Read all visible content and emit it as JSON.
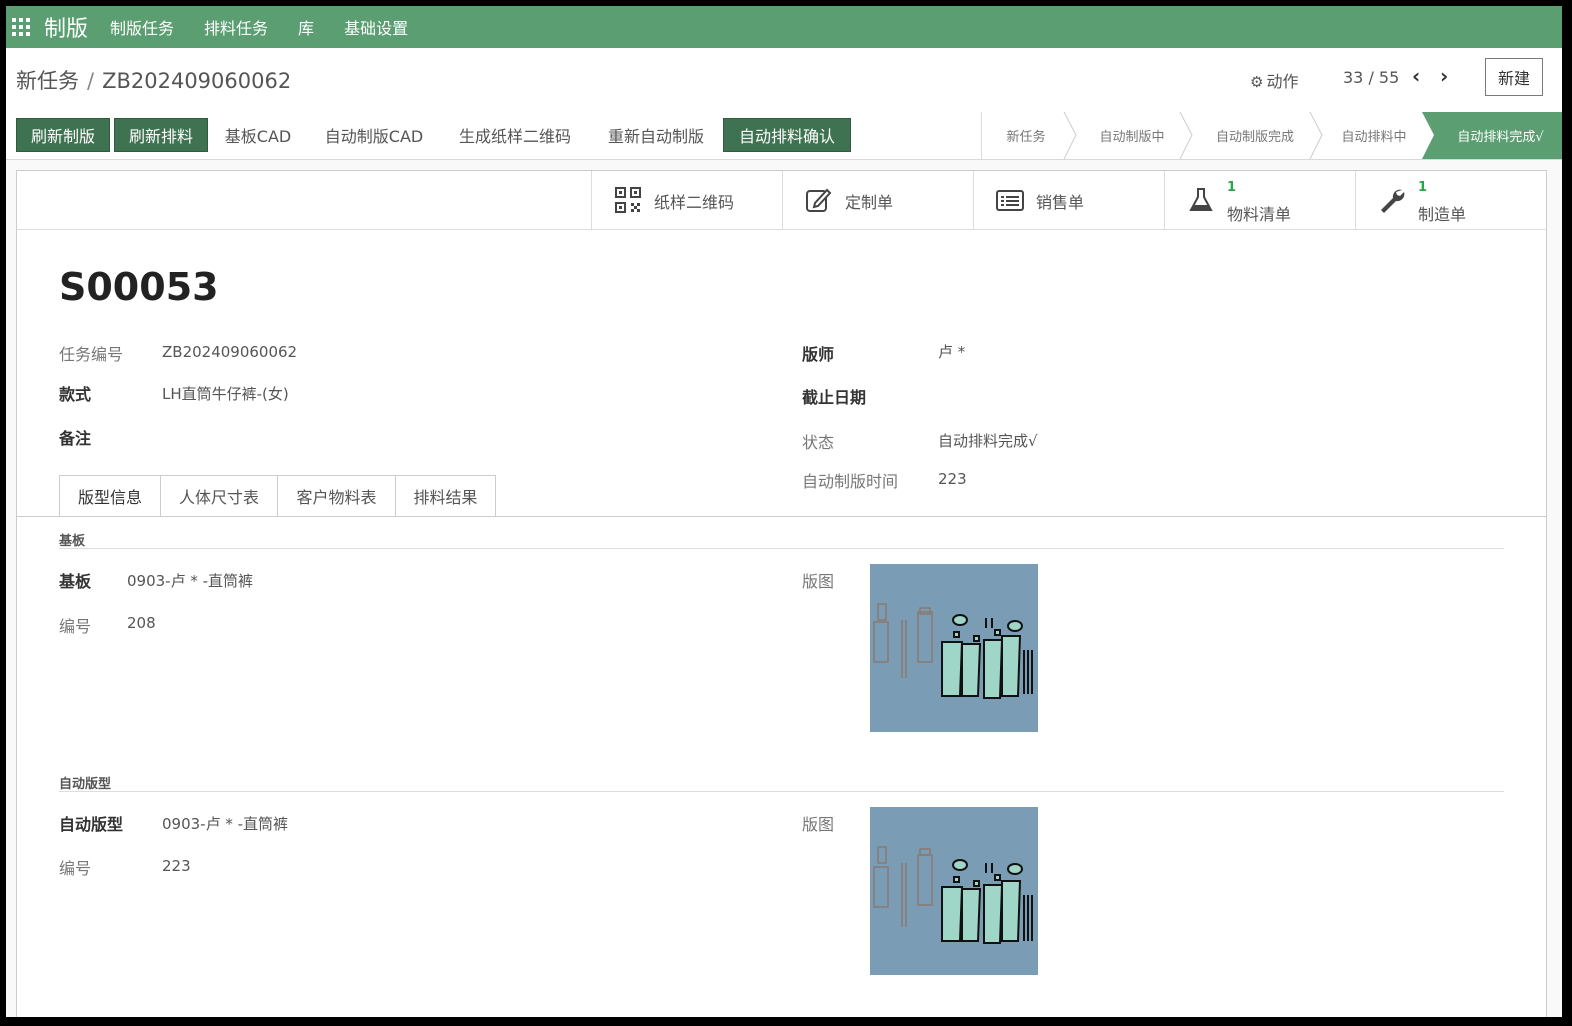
{
  "topnav": {
    "app_name": "制版",
    "items": [
      "制版任务",
      "排料任务",
      "库",
      "基础设置"
    ]
  },
  "header": {
    "breadcrumb_parent": "新任务",
    "breadcrumb_current": "ZB202409060062",
    "action_label": "动作",
    "pager": "33 / 55",
    "new_label": "新建"
  },
  "statusbar": {
    "buttons": [
      "刷新制版",
      "刷新排料",
      "基板CAD",
      "自动制版CAD",
      "生成纸样二维码",
      "重新自动制版",
      "自动排料确认"
    ],
    "steps": [
      "新任务",
      "自动制版中",
      "自动制版完成",
      "自动排料中",
      "自动排料完成√"
    ]
  },
  "smart_buttons": {
    "qr": "纸样二维码",
    "custom": "定制单",
    "sales": "销售单",
    "bom_count": "1",
    "bom": "物料清单",
    "mo_count": "1",
    "mo": "制造单"
  },
  "record": {
    "title": "S00053",
    "left": {
      "task_no_label": "任务编号",
      "task_no": "ZB202409060062",
      "style_label": "款式",
      "style": "LH直筒牛仔裤-(女)",
      "note_label": "备注"
    },
    "right": {
      "maker_label": "版师",
      "maker": "卢 *",
      "deadline_label": "截止日期",
      "state_label": "状态",
      "state": "自动排料完成√",
      "auto_time_label": "自动制版时间",
      "auto_time": "223"
    }
  },
  "tabs": [
    "版型信息",
    "人体尺寸表",
    "客户物料表",
    "排料结果"
  ],
  "base_section": {
    "title": "基板",
    "base_label": "基板",
    "base_value": "0903-卢 * -直筒裤",
    "no_label": "编号",
    "no_value": "208",
    "image_label": "版图"
  },
  "auto_section": {
    "title": "自动版型",
    "pattern_label": "自动版型",
    "pattern_value": "0903-卢 * -直筒裤",
    "no_label": "编号",
    "no_value": "223",
    "image_label": "版图"
  },
  "colors": {
    "brand": "#5a9e71",
    "primary_button": "#3f7250",
    "preview_bg": "#7a9cb4",
    "pattern_piece": "#9fd6c8"
  }
}
